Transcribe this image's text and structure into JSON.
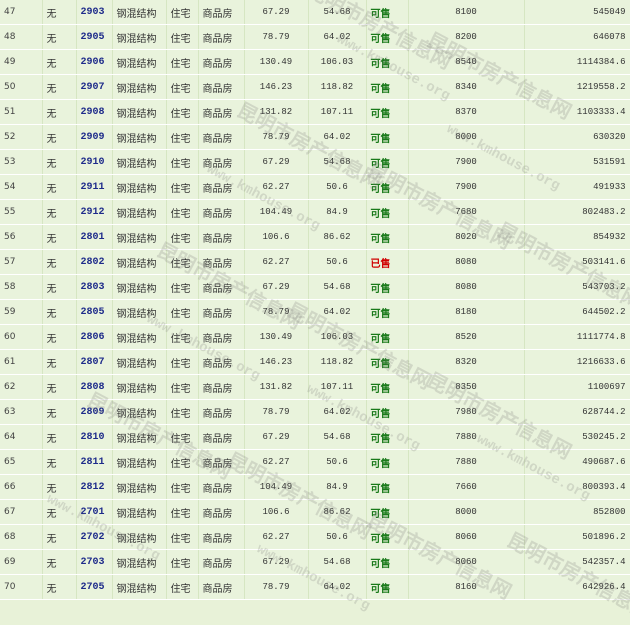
{
  "rows": [
    {
      "idx": "47",
      "none": "无",
      "room": "2903",
      "structure": "钢混结构",
      "usage": "住宅",
      "type": "商品房",
      "area": "67.29",
      "inner": "54.68",
      "status": "可售",
      "price": "8100",
      "total": "545049"
    },
    {
      "idx": "48",
      "none": "无",
      "room": "2905",
      "structure": "钢混结构",
      "usage": "住宅",
      "type": "商品房",
      "area": "78.79",
      "inner": "64.02",
      "status": "可售",
      "price": "8200",
      "total": "646078"
    },
    {
      "idx": "49",
      "none": "无",
      "room": "2906",
      "structure": "钢混结构",
      "usage": "住宅",
      "type": "商品房",
      "area": "130.49",
      "inner": "106.03",
      "status": "可售",
      "price": "8540",
      "total": "1114384.6"
    },
    {
      "idx": "50",
      "none": "无",
      "room": "2907",
      "structure": "钢混结构",
      "usage": "住宅",
      "type": "商品房",
      "area": "146.23",
      "inner": "118.82",
      "status": "可售",
      "price": "8340",
      "total": "1219558.2"
    },
    {
      "idx": "51",
      "none": "无",
      "room": "2908",
      "structure": "钢混结构",
      "usage": "住宅",
      "type": "商品房",
      "area": "131.82",
      "inner": "107.11",
      "status": "可售",
      "price": "8370",
      "total": "1103333.4"
    },
    {
      "idx": "52",
      "none": "无",
      "room": "2909",
      "structure": "钢混结构",
      "usage": "住宅",
      "type": "商品房",
      "area": "78.79",
      "inner": "64.02",
      "status": "可售",
      "price": "8000",
      "total": "630320"
    },
    {
      "idx": "53",
      "none": "无",
      "room": "2910",
      "structure": "钢混结构",
      "usage": "住宅",
      "type": "商品房",
      "area": "67.29",
      "inner": "54.68",
      "status": "可售",
      "price": "7900",
      "total": "531591"
    },
    {
      "idx": "54",
      "none": "无",
      "room": "2911",
      "structure": "钢混结构",
      "usage": "住宅",
      "type": "商品房",
      "area": "62.27",
      "inner": "50.6",
      "status": "可售",
      "price": "7900",
      "total": "491933"
    },
    {
      "idx": "55",
      "none": "无",
      "room": "2912",
      "structure": "钢混结构",
      "usage": "住宅",
      "type": "商品房",
      "area": "104.49",
      "inner": "84.9",
      "status": "可售",
      "price": "7680",
      "total": "802483.2"
    },
    {
      "idx": "56",
      "none": "无",
      "room": "2801",
      "structure": "钢混结构",
      "usage": "住宅",
      "type": "商品房",
      "area": "106.6",
      "inner": "86.62",
      "status": "可售",
      "price": "8020",
      "total": "854932"
    },
    {
      "idx": "57",
      "none": "无",
      "room": "2802",
      "structure": "钢混结构",
      "usage": "住宅",
      "type": "商品房",
      "area": "62.27",
      "inner": "50.6",
      "status": "已售",
      "price": "8080",
      "total": "503141.6"
    },
    {
      "idx": "58",
      "none": "无",
      "room": "2803",
      "structure": "钢混结构",
      "usage": "住宅",
      "type": "商品房",
      "area": "67.29",
      "inner": "54.68",
      "status": "可售",
      "price": "8080",
      "total": "543703.2"
    },
    {
      "idx": "59",
      "none": "无",
      "room": "2805",
      "structure": "钢混结构",
      "usage": "住宅",
      "type": "商品房",
      "area": "78.79",
      "inner": "64.02",
      "status": "可售",
      "price": "8180",
      "total": "644502.2"
    },
    {
      "idx": "60",
      "none": "无",
      "room": "2806",
      "structure": "钢混结构",
      "usage": "住宅",
      "type": "商品房",
      "area": "130.49",
      "inner": "106.03",
      "status": "可售",
      "price": "8520",
      "total": "1111774.8"
    },
    {
      "idx": "61",
      "none": "无",
      "room": "2807",
      "structure": "钢混结构",
      "usage": "住宅",
      "type": "商品房",
      "area": "146.23",
      "inner": "118.82",
      "status": "可售",
      "price": "8320",
      "total": "1216633.6"
    },
    {
      "idx": "62",
      "none": "无",
      "room": "2808",
      "structure": "钢混结构",
      "usage": "住宅",
      "type": "商品房",
      "area": "131.82",
      "inner": "107.11",
      "status": "可售",
      "price": "8350",
      "total": "1100697"
    },
    {
      "idx": "63",
      "none": "无",
      "room": "2809",
      "structure": "钢混结构",
      "usage": "住宅",
      "type": "商品房",
      "area": "78.79",
      "inner": "64.02",
      "status": "可售",
      "price": "7980",
      "total": "628744.2"
    },
    {
      "idx": "64",
      "none": "无",
      "room": "2810",
      "structure": "钢混结构",
      "usage": "住宅",
      "type": "商品房",
      "area": "67.29",
      "inner": "54.68",
      "status": "可售",
      "price": "7880",
      "total": "530245.2"
    },
    {
      "idx": "65",
      "none": "无",
      "room": "2811",
      "structure": "钢混结构",
      "usage": "住宅",
      "type": "商品房",
      "area": "62.27",
      "inner": "50.6",
      "status": "可售",
      "price": "7880",
      "total": "490687.6"
    },
    {
      "idx": "66",
      "none": "无",
      "room": "2812",
      "structure": "钢混结构",
      "usage": "住宅",
      "type": "商品房",
      "area": "104.49",
      "inner": "84.9",
      "status": "可售",
      "price": "7660",
      "total": "800393.4"
    },
    {
      "idx": "67",
      "none": "无",
      "room": "2701",
      "structure": "钢混结构",
      "usage": "住宅",
      "type": "商品房",
      "area": "106.6",
      "inner": "86.62",
      "status": "可售",
      "price": "8000",
      "total": "852800"
    },
    {
      "idx": "68",
      "none": "无",
      "room": "2702",
      "structure": "钢混结构",
      "usage": "住宅",
      "type": "商品房",
      "area": "62.27",
      "inner": "50.6",
      "status": "可售",
      "price": "8060",
      "total": "501896.2"
    },
    {
      "idx": "69",
      "none": "无",
      "room": "2703",
      "structure": "钢混结构",
      "usage": "住宅",
      "type": "商品房",
      "area": "67.29",
      "inner": "54.68",
      "status": "可售",
      "price": "8060",
      "total": "542357.4"
    },
    {
      "idx": "70",
      "none": "无",
      "room": "2705",
      "structure": "钢混结构",
      "usage": "住宅",
      "type": "商品房",
      "area": "78.79",
      "inner": "64.02",
      "status": "可售",
      "price": "8160",
      "total": "642926.4"
    }
  ],
  "watermark": {
    "cn": "昆明市房产信息网",
    "en": "www.kmhouse.org"
  },
  "colors": {
    "row_bg": "#e9f3dc",
    "room_link": "#1d2a8a",
    "status_available": "#1a7a1a",
    "status_sold": "#d00000"
  }
}
